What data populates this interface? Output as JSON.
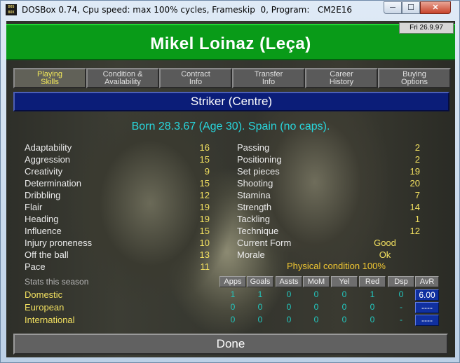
{
  "window": {
    "title": "DOSBox 0.74, Cpu speed: max 100% cycles, Frameskip  0, Program:   CM2E16",
    "icon_text": "DOS BOX",
    "min_glyph": "─",
    "max_glyph": "☐",
    "close_glyph": "✕"
  },
  "header": {
    "date": "Fri 26.9.97",
    "player_name": "Mikel Loinaz (Leça)"
  },
  "tabs": [
    {
      "line1": "Playing",
      "line2": "Skills",
      "active": true
    },
    {
      "line1": "Condition &",
      "line2": "Availability",
      "active": false
    },
    {
      "line1": "Contract",
      "line2": "Info",
      "active": false
    },
    {
      "line1": "Transfer",
      "line2": "Info",
      "active": false
    },
    {
      "line1": "Career",
      "line2": "History",
      "active": false
    },
    {
      "line1": "Buying",
      "line2": "Options",
      "active": false
    }
  ],
  "position": "Striker (Centre)",
  "born_line": "Born 28.3.67 (Age 30). Spain (no caps).",
  "attributes_left": [
    {
      "name": "Adaptability",
      "value": "16"
    },
    {
      "name": "Aggression",
      "value": "15"
    },
    {
      "name": "Creativity",
      "value": "9"
    },
    {
      "name": "Determination",
      "value": "15"
    },
    {
      "name": "Dribbling",
      "value": "12"
    },
    {
      "name": "Flair",
      "value": "19"
    },
    {
      "name": "Heading",
      "value": "19"
    },
    {
      "name": "Influence",
      "value": "15"
    },
    {
      "name": "Injury proneness",
      "value": "10"
    },
    {
      "name": "Off the ball",
      "value": "13"
    },
    {
      "name": "Pace",
      "value": "11"
    }
  ],
  "attributes_right": [
    {
      "name": "Passing",
      "value": "2"
    },
    {
      "name": "Positioning",
      "value": "2"
    },
    {
      "name": "Set pieces",
      "value": "19"
    },
    {
      "name": "Shooting",
      "value": "20"
    },
    {
      "name": "Stamina",
      "value": "7"
    },
    {
      "name": "Strength",
      "value": "14"
    },
    {
      "name": "Tackling",
      "value": "1"
    },
    {
      "name": "Technique",
      "value": "12"
    },
    {
      "name": "Current Form",
      "value": "Good"
    },
    {
      "name": "Morale",
      "value": "Ok"
    }
  ],
  "physical_condition": "Physical condition 100%",
  "stats": {
    "title": "Stats this season",
    "columns": [
      "Apps",
      "Goals",
      "Assts",
      "MoM",
      "Yel",
      "Red",
      "Dsp",
      "AvR"
    ],
    "rows": [
      {
        "label": "Domestic",
        "values": [
          "1",
          "1",
          "0",
          "0",
          "0",
          "1",
          "0"
        ],
        "avr": "6.00"
      },
      {
        "label": "European",
        "values": [
          "0",
          "0",
          "0",
          "0",
          "0",
          "0",
          "-"
        ],
        "avr": "----"
      },
      {
        "label": "International",
        "values": [
          "0",
          "0",
          "0",
          "0",
          "0",
          "0",
          "-"
        ],
        "avr": "----"
      }
    ]
  },
  "done_label": "Done",
  "colors": {
    "banner": "#099b18",
    "position_bar": "#0b1d78",
    "born_text": "#28d6dc",
    "value_text": "#f2e060",
    "stat_text": "#22c9c0"
  }
}
